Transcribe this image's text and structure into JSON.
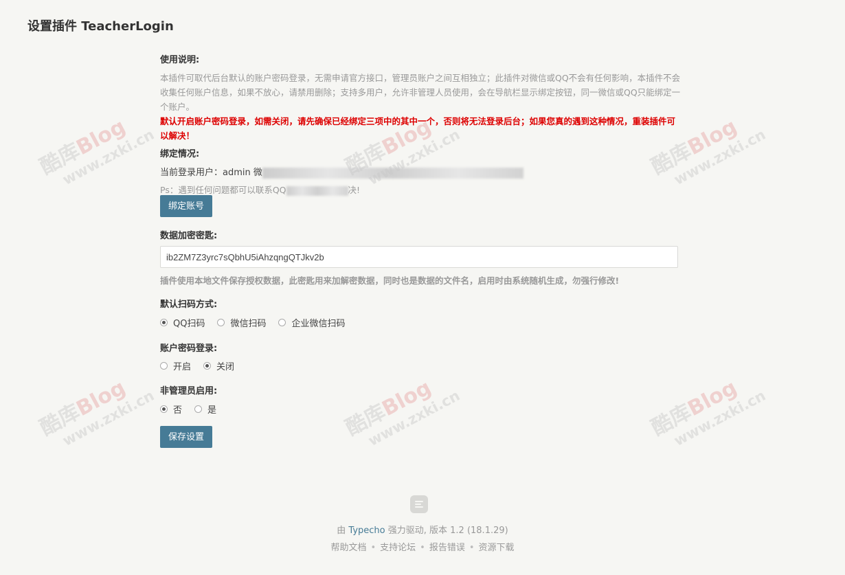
{
  "title": "设置插件 TeacherLogin",
  "usage": {
    "label": "使用说明:",
    "desc": "本插件可取代后台默认的账户密码登录，无需申请官方接口，管理员账户之间互相独立；此插件对微信或QQ不会有任何影响，本插件不会收集任何账户信息，如果不放心，请禁用删除；支持多用户，允许非管理人员使用，会在导航栏显示绑定按钮，同一微信或QQ只能绑定一个账户。",
    "warning": "默认开启账户密码登录，如需关闭，请先确保已经绑定三项中的其中一个，否则将无法登录后台；如果您真的遇到这种情况，重装插件可以解决！"
  },
  "binding": {
    "label": "绑定情况:",
    "current_user_prefix": "当前登录用户：admin  微",
    "ps_prefix": "Ps：遇到任何问题都可以联系QQ",
    "ps_suffix": "决!",
    "bind_button": "绑定账号"
  },
  "encryption": {
    "label": "数据加密密匙:",
    "value": "ib2ZM7Z3yrc7sQbhU5iAhzqngQTJkv2b",
    "hint": "插件使用本地文件保存授权数据，此密匙用来加解密数据，同时也是数据的文件名，启用时由系统随机生成，勿强行修改!"
  },
  "scan": {
    "label": "默认扫码方式:",
    "options": [
      "QQ扫码",
      "微信扫码",
      "企业微信扫码"
    ],
    "selected": 0
  },
  "password_login": {
    "label": "账户密码登录:",
    "options": [
      "开启",
      "关闭"
    ],
    "selected": 1
  },
  "non_admin": {
    "label": "非管理员启用:",
    "options": [
      "否",
      "是"
    ],
    "selected": 0
  },
  "save_button": "保存设置",
  "footer": {
    "powered_prefix": "由 ",
    "powered_link": "Typecho",
    "powered_suffix": " 强力驱动, 版本 1.2 (18.1.29)",
    "links": [
      "帮助文档",
      "支持论坛",
      "报告错误",
      "资源下载"
    ]
  },
  "watermark": {
    "line1a": "酷库",
    "line1b": "Blog",
    "line2": "www.zxki.cn"
  }
}
